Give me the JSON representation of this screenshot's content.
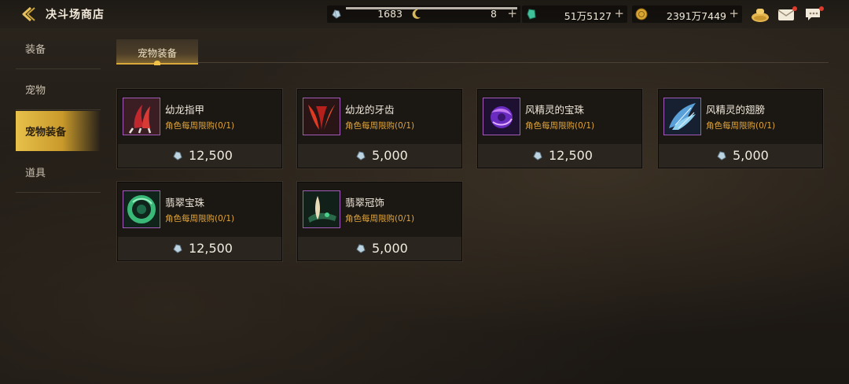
{
  "header": {
    "title": "决斗场商店"
  },
  "resources": {
    "arena_tokens": {
      "value": "1683",
      "icon": "crystal-token-icon",
      "progress_pct": 100
    },
    "moon_coins": {
      "value": "8",
      "icon": "moon-coin-icon"
    },
    "gems": {
      "value": "51万5127",
      "icon": "green-gem-icon"
    },
    "gold": {
      "value": "2391万7449",
      "icon": "gold-coin-icon"
    }
  },
  "sidebar": {
    "items": [
      {
        "label": "装备",
        "active": false
      },
      {
        "label": "宠物",
        "active": false
      },
      {
        "label": "宠物装备",
        "active": true
      },
      {
        "label": "道具",
        "active": false
      }
    ]
  },
  "tabs": [
    {
      "label": "宠物装备",
      "active": true
    }
  ],
  "items": [
    {
      "name": "幼龙指甲",
      "limit": "角色每周限购(0/1)",
      "price": "12,500",
      "icon": "dragon-claw-icon"
    },
    {
      "name": "幼龙的牙齿",
      "limit": "角色每周限购(0/1)",
      "price": "5,000",
      "icon": "dragon-fang-icon"
    },
    {
      "name": "风精灵的宝珠",
      "limit": "角色每周限购(0/1)",
      "price": "12,500",
      "icon": "wind-orb-icon"
    },
    {
      "name": "风精灵的翅膀",
      "limit": "角色每周限购(0/1)",
      "price": "5,000",
      "icon": "wind-wing-icon"
    },
    {
      "name": "翡翠宝珠",
      "limit": "角色每周限购(0/1)",
      "price": "12,500",
      "icon": "emerald-orb-icon"
    },
    {
      "name": "翡翠冠饰",
      "limit": "角色每周限购(0/1)",
      "price": "5,000",
      "icon": "emerald-crown-icon"
    }
  ],
  "colors": {
    "accent_gold": "#e7c04a",
    "limit_text": "#e0a53a",
    "icon_border": "#a25ab8"
  }
}
